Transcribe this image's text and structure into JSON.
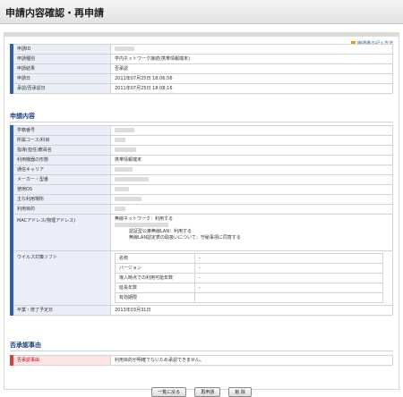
{
  "header": {
    "title": "申請内容確認・再申請"
  },
  "help_link": "申請書の記入方法",
  "summary": [
    {
      "label": "申請ID",
      "value": ""
    },
    {
      "label": "申請種別",
      "value": "学内ネットワーク接続(携帯情報端末)"
    },
    {
      "label": "申請結果",
      "value": "否承認"
    },
    {
      "label": "申請日",
      "value": "2011年07月25日 18:06:56"
    },
    {
      "label": "承認/否承認日",
      "value": "2011年07月25日 18:08:16"
    }
  ],
  "content_section": {
    "title": "申請内容"
  },
  "content": [
    {
      "label": "学籍番号",
      "value": ""
    },
    {
      "label": "所属コース/科目",
      "value": ""
    },
    {
      "label": "指導(担任)教員名",
      "value": ""
    },
    {
      "label": "利用機器の形態",
      "value": "携帯情報端末"
    },
    {
      "label": "通信キャリア",
      "value": ""
    },
    {
      "label": "メーカー・型番",
      "value": ""
    },
    {
      "label": "使用OS",
      "value": ""
    },
    {
      "label": "主な利用場所",
      "value": ""
    },
    {
      "label": "利用目的",
      "value": ""
    }
  ],
  "mac": {
    "label": "MACアドレス(物理アドレス)",
    "line1": "無線ネットワーク：利用する",
    "line2": "認証型公衆無線LAN：利用する",
    "line3": "無線LAN認定表の取扱いについて：守秘事項に同意する"
  },
  "antivirus": {
    "label": "ウイルス対策ソフト",
    "rows": [
      {
        "label": "名称",
        "value": "-"
      },
      {
        "label": "バージョン",
        "value": "-"
      },
      {
        "label": "導入時点での利用可能年数",
        "value": "-"
      },
      {
        "label": "延長年数",
        "value": "-"
      },
      {
        "label": "有効期限",
        "value": ""
      }
    ]
  },
  "graduation": {
    "label": "卒業・修了予定日",
    "value": "2013年03月31日"
  },
  "reject_section": {
    "title": "否承認事由"
  },
  "reject": {
    "label": "否承認事由",
    "value": "利用目的が明確でないため承認できません。"
  },
  "buttons": {
    "back": "一覧に戻る",
    "reapply": "再申請",
    "delete": "削 除"
  }
}
